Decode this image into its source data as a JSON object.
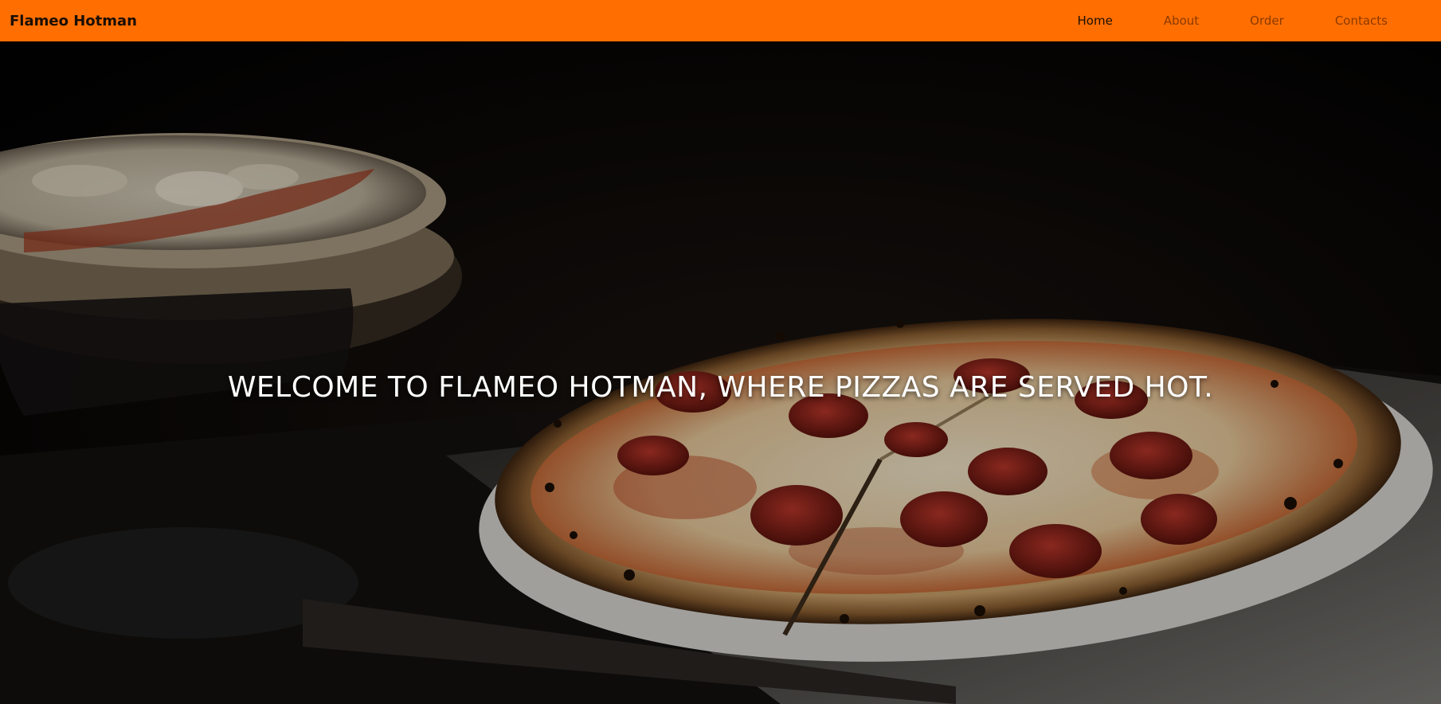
{
  "navbar": {
    "brand": "Flameo Hotman",
    "links": [
      {
        "label": "Home",
        "active": true
      },
      {
        "label": "About",
        "active": false
      },
      {
        "label": "Order",
        "active": false
      },
      {
        "label": "Contacts",
        "active": false
      }
    ]
  },
  "hero": {
    "heading": "WELCOME TO FLAMEO HOTMAN, WHERE PIZZAS ARE SERVED HOT.",
    "image_subject": "pepperoni pizza on a pizza peel in a dark oven"
  },
  "colors": {
    "navbar_bg": "#ff6e00",
    "nav_active": "#1a0f05",
    "nav_inactive": "#8a3a00",
    "heading": "#ffffff"
  }
}
